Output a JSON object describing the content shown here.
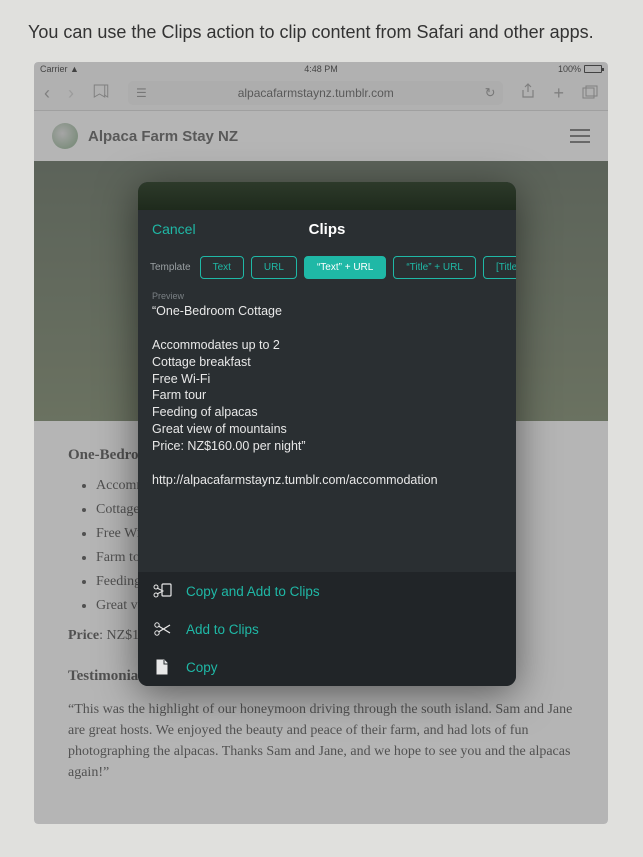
{
  "caption": "You can use the Clips action to clip content from Safari and other apps.",
  "status": {
    "carrier": "Carrier",
    "time": "4:48 PM",
    "battery": "100%"
  },
  "nav": {
    "url": "alpacafarmstaynz.tumblr.com"
  },
  "site": {
    "title": "Alpaca Farm Stay NZ"
  },
  "article": {
    "heading": "One-Bedroom Cottage",
    "bullets": [
      "Accommodates up to 2",
      "Cottage breakfast",
      "Free Wi-Fi",
      "Farm tour",
      "Feeding of alpacas",
      "Great view of mountains"
    ],
    "price_label": "Price",
    "price_value": ": NZ$160.00 per night",
    "testimonial_heading": "Testimonial",
    "testimonial_body": "“This was the highlight of our honeymoon driving through the south island. Sam and Jane are great hosts. We enjoyed the beauty and peace of their farm, and had lots of fun photographing the alpacas. Thanks Sam and Jane, and we hope to see you and the alpacas again!”"
  },
  "clips": {
    "cancel": "Cancel",
    "title": "Clips",
    "template_label": "Template",
    "templates": [
      {
        "label": "Text",
        "active": false
      },
      {
        "label": "URL",
        "active": false
      },
      {
        "label": "“Text” + URL",
        "active": true
      },
      {
        "label": "“Title” + URL",
        "active": false
      },
      {
        "label": "[Title](URL)",
        "active": false
      }
    ],
    "preview_label": "Preview",
    "preview_text": "“One-Bedroom Cottage\n\nAccommodates up to 2\nCottage breakfast\nFree Wi-Fi\nFarm tour\nFeeding of alpacas\nGreat view of mountains\nPrice: NZ$160.00 per night”\n\nhttp://alpacafarmstaynz.tumblr.com/accommodation",
    "actions": [
      {
        "key": "copy-add",
        "label": "Copy and Add to Clips"
      },
      {
        "key": "add",
        "label": "Add to Clips"
      },
      {
        "key": "copy",
        "label": "Copy"
      }
    ]
  }
}
